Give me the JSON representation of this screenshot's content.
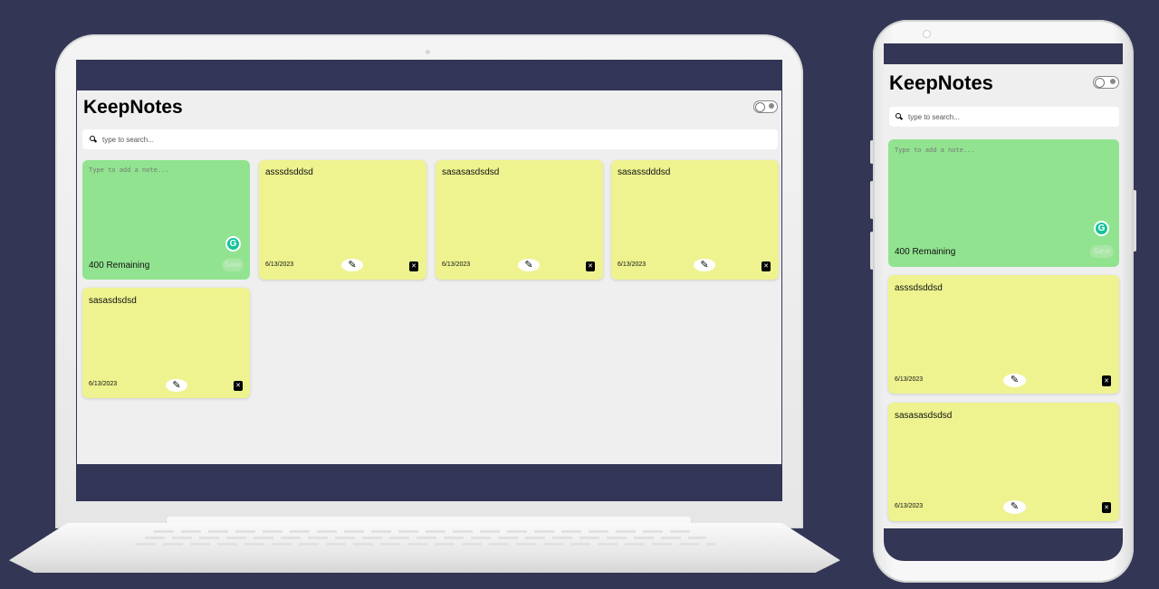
{
  "app": {
    "title": "KeepNotes",
    "search_placeholder": "type to search...",
    "new_note": {
      "placeholder": "Type to add a note...",
      "remaining_text": "400 Remaining",
      "save_label": "Save",
      "grammarly_glyph": "G"
    },
    "notes": [
      {
        "text": "asssdsddsd",
        "date": "6/13/2023"
      },
      {
        "text": "sasasasdsdsd",
        "date": "6/13/2023"
      },
      {
        "text": "sasassdddsd",
        "date": "6/13/2023"
      },
      {
        "text": "sasasdsdsd",
        "date": "6/13/2023"
      }
    ],
    "icons": {
      "edit": "pencil-icon",
      "delete": "trash-icon",
      "search": "search-icon",
      "theme_toggle": "dark-mode-toggle"
    }
  },
  "glyphs": {
    "edit": "✎",
    "delete": "✕"
  },
  "colors": {
    "background": "#343655",
    "new_note": "#91e38f",
    "saved_note": "#eef38f",
    "app_bg": "#efefef"
  }
}
